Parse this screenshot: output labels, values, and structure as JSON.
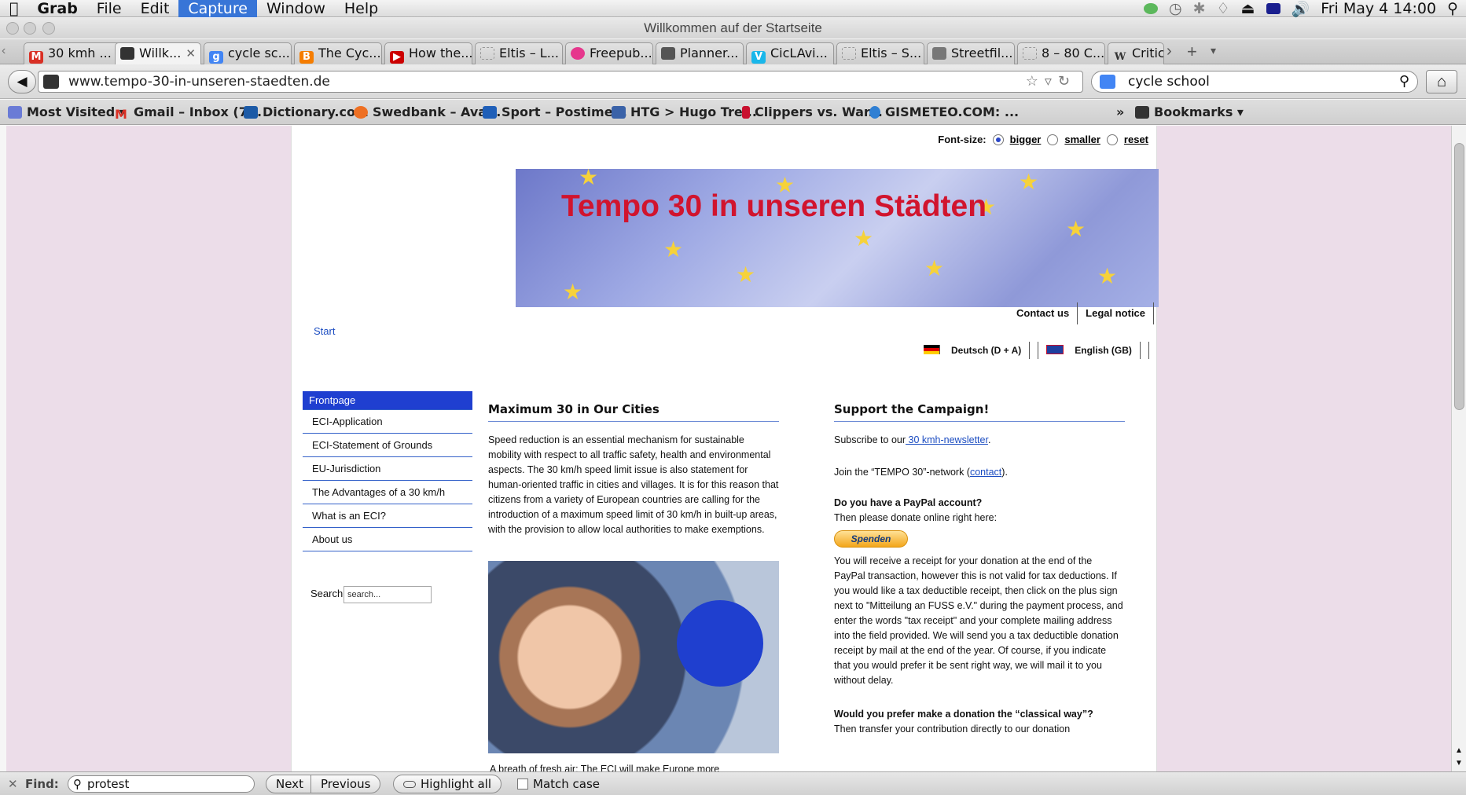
{
  "menubar": {
    "apple": "",
    "app": "Grab",
    "items": [
      "File",
      "Edit",
      "Capture",
      "Window",
      "Help"
    ],
    "clock": "Fri May 4  14:00"
  },
  "window": {
    "title": "Willkommen auf der Startseite"
  },
  "tabs": [
    {
      "label": "30 kmh ...",
      "icon": "gmail-icon",
      "color": "#d93025"
    },
    {
      "label": "Willk...",
      "icon": "tempo30-favicon",
      "color": "#333333",
      "active": true
    },
    {
      "label": "cycle sc...",
      "icon": "google-icon",
      "color": "#4285f4"
    },
    {
      "label": "The Cyc...",
      "icon": "blogger-icon",
      "color": "#f57d00"
    },
    {
      "label": "How the...",
      "icon": "youtube-icon",
      "color": "#cc0000"
    },
    {
      "label": "Eltis – L...",
      "icon": "page-icon",
      "color": "#bbbbbb"
    },
    {
      "label": "Freepub...",
      "icon": "freepub-icon",
      "color": "#e6378d"
    },
    {
      "label": "Planner...",
      "icon": "planner-icon",
      "color": "#555555"
    },
    {
      "label": "CicLAvi...",
      "icon": "vimeo-icon",
      "color": "#1ab7ea"
    },
    {
      "label": "Eltis – S...",
      "icon": "page-icon",
      "color": "#bbbbbb"
    },
    {
      "label": "Streetfil...",
      "icon": "streetfilms-icon",
      "color": "#777777"
    },
    {
      "label": "8 – 80 C...",
      "icon": "page-icon",
      "color": "#bbbbbb"
    },
    {
      "label": "Critic",
      "icon": "wikipedia-icon",
      "color": "#999999"
    }
  ],
  "nav": {
    "url": "www.tempo-30-in-unseren-staedten.de",
    "search": "cycle school"
  },
  "bookmarks": [
    {
      "label": "Most Visited ▾",
      "color": "#6a7bd6"
    },
    {
      "label": "Gmail – Inbox (7...",
      "color": "#d93025"
    },
    {
      "label": "Dictionary.com",
      "color": "#1c5aa6"
    },
    {
      "label": "Swedbank – Ava...",
      "color": "#ee7023"
    },
    {
      "label": "Sport – Postime...",
      "color": "#1f5fb8"
    },
    {
      "label": "HTG > Hugo Tre...",
      "color": "#3a62a8"
    },
    {
      "label": "Clippers vs. War...",
      "color": "#c8102e"
    },
    {
      "label": "GISMETEO.COM: ...",
      "color": "#2f7fd3"
    }
  ],
  "bookmarks_menu": "Bookmarks ▾",
  "site": {
    "fontsize_label": "Font-size:",
    "bigger": "bigger",
    "smaller": "smaller",
    "reset": "reset",
    "banner_title": "Tempo 30 in unseren Städten",
    "contact": "Contact us",
    "legal": "Legal notice",
    "breadcrumb": "Start",
    "lang_de": "Deutsch (D + A)",
    "lang_en": "English (GB)",
    "menu": [
      "Frontpage",
      "ECI-Application",
      "ECI-Statement of Grounds",
      "EU-Jurisdiction",
      "The Advantages of a 30 km/h",
      "What is an ECI?",
      "About us"
    ],
    "search_label": "Search",
    "search_placeholder": "search...",
    "main_heading": "Maximum 30 in Our Cities",
    "main_text": "Speed reduction is an essential mechanism for sustainable mobility with respect to all traffic safety, health and environmental aspects. The 30 km/h speed limit issue is also statement for human-oriented traffic in cities and villages. It is for this reason that citizens from a variety of European countries are calling for the introduction of a maximum speed limit of 30 km/h in built-up areas, with the provision to allow local authorities to make exemptions.",
    "caption": "A breath of fresh air: The ECI will make Europe more",
    "side_heading": "Support the Campaign!",
    "subscribe_pre": "Subscribe to our",
    "subscribe_link": " 30 kmh-newsletter",
    "subscribe_post": ".",
    "join_pre": "Join the “TEMPO 30”-network (",
    "join_link": "contact",
    "join_post": ").",
    "paypal_q": "Do you have a PayPal account?",
    "paypal_sub": "Then please donate online right here:",
    "donate_btn": "Spenden",
    "receipt_text": "You will receive a receipt for your donation at the end of the PayPal transaction, however this is not valid for tax deductions. If you would like a tax deductible receipt, then click on the plus sign next to \"Mitteilung an FUSS e.V.\" during the payment process, and enter the words \"tax receipt\" and your complete mailing address into the field provided. We will send you a tax deductible donation receipt by mail at the end of the year. Of course, if you indicate that you would prefer it be sent right way, we will mail it to you without delay.",
    "classical_q": "Would you prefer make a donation the “classical way”?",
    "classical_sub": "Then transfer your contribution directly to our donation"
  },
  "findbar": {
    "close": "✕",
    "label": "Find:",
    "query": "protest",
    "next": "Next",
    "previous": "Previous",
    "highlight": "Highlight all",
    "match": "Match case"
  }
}
